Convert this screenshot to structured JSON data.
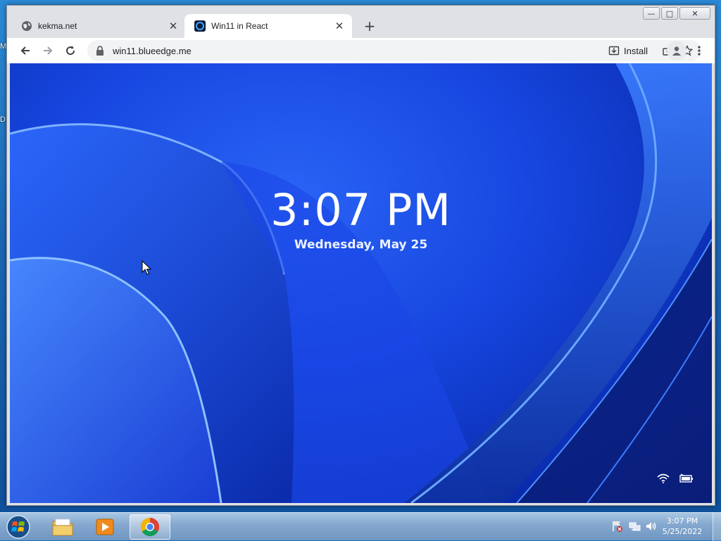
{
  "desktop": {
    "edge_labels": [
      "M",
      "D"
    ]
  },
  "browser": {
    "tabs": [
      {
        "title": "kekma.net",
        "favicon": "globe-icon",
        "active": false
      },
      {
        "title": "Win11 in React",
        "favicon": "win11-favicon",
        "active": true
      }
    ],
    "new_tab_icon": "plus-icon",
    "window_controls": {
      "minimize": "minimize-icon",
      "maximize": "maximize-icon",
      "close": "close-icon"
    },
    "toolbar": {
      "back_icon": "back-arrow-icon",
      "forward_icon": "forward-arrow-icon",
      "reload_icon": "reload-icon",
      "url": "win11.blueedge.me",
      "install_label": "Install",
      "share_icon": "share-icon",
      "bookmark_icon": "star-icon",
      "profile_icon": "profile-icon",
      "menu_icon": "kebab-menu-icon"
    }
  },
  "lockscreen": {
    "time": "3:07 PM",
    "date": "Wednesday, May 25",
    "status_icons": [
      "wifi-icon",
      "battery-icon"
    ],
    "accent_color": "#1a4ff0"
  },
  "taskbar": {
    "apps": [
      {
        "name": "windows-explorer",
        "icon": "folder-icon",
        "active": false
      },
      {
        "name": "media-player",
        "icon": "media-player-icon",
        "active": false
      },
      {
        "name": "chrome",
        "icon": "chrome-icon",
        "active": true
      }
    ],
    "tray_icons": [
      "action-center-icon",
      "network-icon",
      "volume-icon"
    ],
    "clock_time": "3:07 PM",
    "clock_date": "5/25/2022"
  }
}
